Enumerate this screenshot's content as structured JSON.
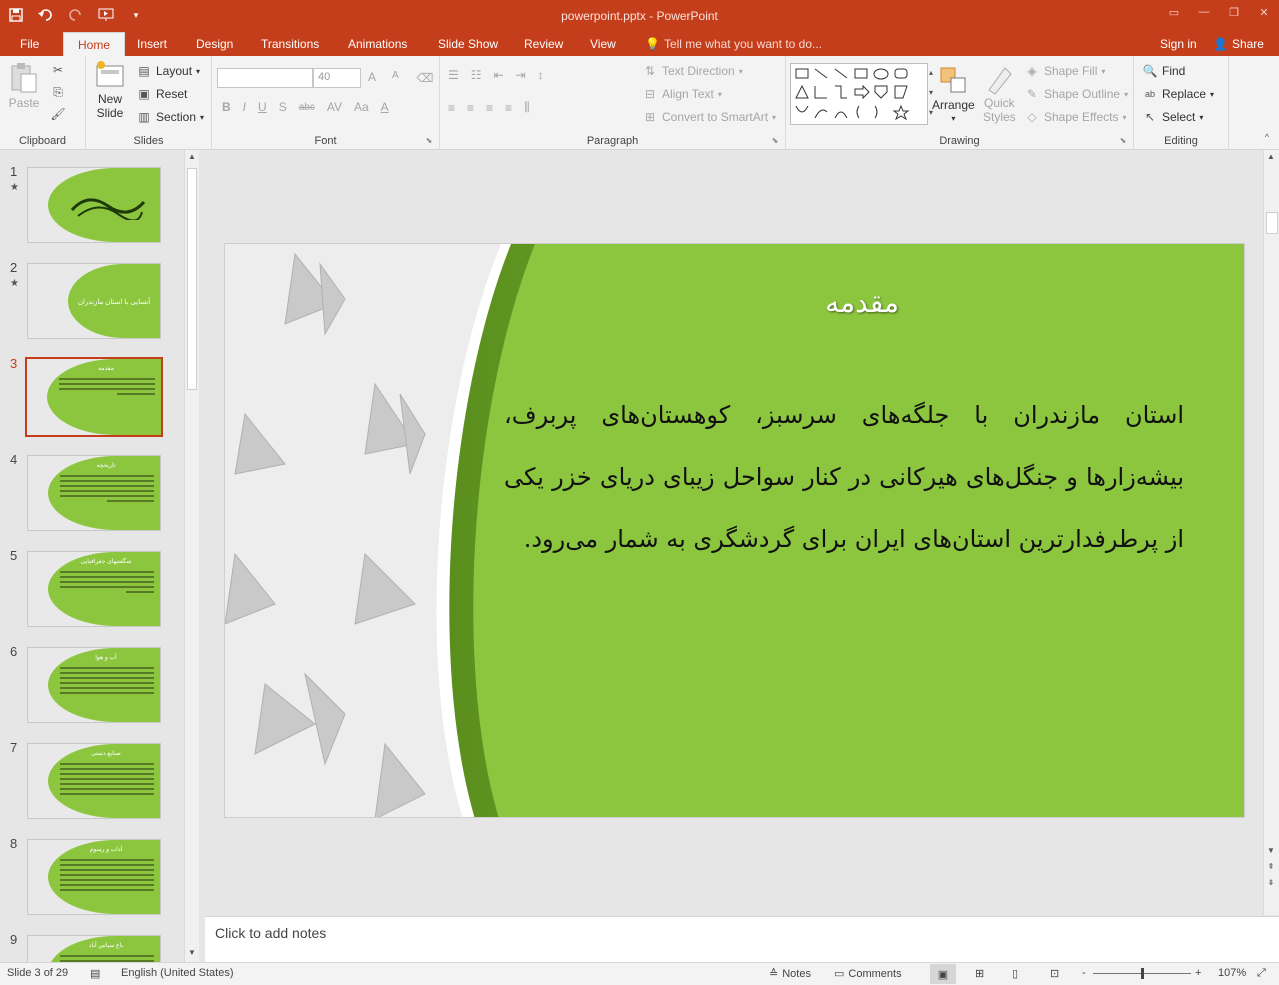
{
  "title_bar": {
    "document_title": "powerpoint.pptx - PowerPoint",
    "qat_icons": [
      "save-icon",
      "undo-icon",
      "redo-icon",
      "start-from-beginning-icon",
      "customize-qat-icon"
    ]
  },
  "tabs": {
    "file": "File",
    "home": "Home",
    "insert": "Insert",
    "design": "Design",
    "transitions": "Transitions",
    "animations": "Animations",
    "slide_show": "Slide Show",
    "review": "Review",
    "view": "View",
    "tell_me": "Tell me what you want to do...",
    "sign_in": "Sign in",
    "share": "Share"
  },
  "ribbon": {
    "clipboard": {
      "label": "Clipboard",
      "paste": "Paste"
    },
    "slides": {
      "label": "Slides",
      "new_slide_line1": "New",
      "new_slide_line2": "Slide",
      "layout": "Layout",
      "reset": "Reset",
      "section": "Section"
    },
    "font": {
      "label": "Font",
      "size": "40",
      "bold": "B",
      "italic": "I",
      "underline": "U",
      "shadow": "S",
      "strike": "abc",
      "spacing": "AV",
      "case": "Aa",
      "increase": "A",
      "decrease": "A",
      "color": "A"
    },
    "paragraph": {
      "label": "Paragraph",
      "text_direction": "Text Direction",
      "align_text": "Align Text",
      "convert_smartart": "Convert to SmartArt"
    },
    "drawing": {
      "label": "Drawing",
      "arrange": "Arrange",
      "quick_styles_line1": "Quick",
      "quick_styles_line2": "Styles",
      "shape_fill": "Shape Fill",
      "shape_outline": "Shape Outline",
      "shape_effects": "Shape Effects"
    },
    "editing": {
      "label": "Editing",
      "find": "Find",
      "replace": "Replace",
      "select": "Select"
    }
  },
  "thumbnails": [
    {
      "num": "1",
      "star": "★",
      "title": ""
    },
    {
      "num": "2",
      "star": "★",
      "title": "آشنایی با استان مازندران"
    },
    {
      "num": "3",
      "star": "",
      "title": "مقدمه"
    },
    {
      "num": "4",
      "star": "",
      "title": "تاریخچه"
    },
    {
      "num": "5",
      "star": "",
      "title": "شگفتیهای جغرافیایی"
    },
    {
      "num": "6",
      "star": "",
      "title": "آب و هوا"
    },
    {
      "num": "7",
      "star": "",
      "title": "صنایع دستی"
    },
    {
      "num": "8",
      "star": "",
      "title": "آداب و رسوم"
    },
    {
      "num": "9",
      "star": "",
      "title": "باغ سپاس آباد"
    }
  ],
  "slide": {
    "title": "مقدمه",
    "body": "استان مازندران با جلگه‌های سرسبز، کوهستان‌های پربرف، بیشه‌زارها و جنگل‌های هیرکانی در کنار سواحل زیبای دریای خزر یکی از پرطرفدارترین استان‌های ایران برای گردشگری به شمار می‌رود."
  },
  "notes": {
    "placeholder": "Click to add notes"
  },
  "status": {
    "slide_info": "Slide 3 of 29",
    "language": "English (United States)",
    "notes": "Notes",
    "comments": "Comments",
    "zoom_minus": "-",
    "zoom_plus": "+",
    "zoom": "107%"
  },
  "colors": {
    "accent": "#c43e1c",
    "slide_green": "#8cc63f"
  }
}
